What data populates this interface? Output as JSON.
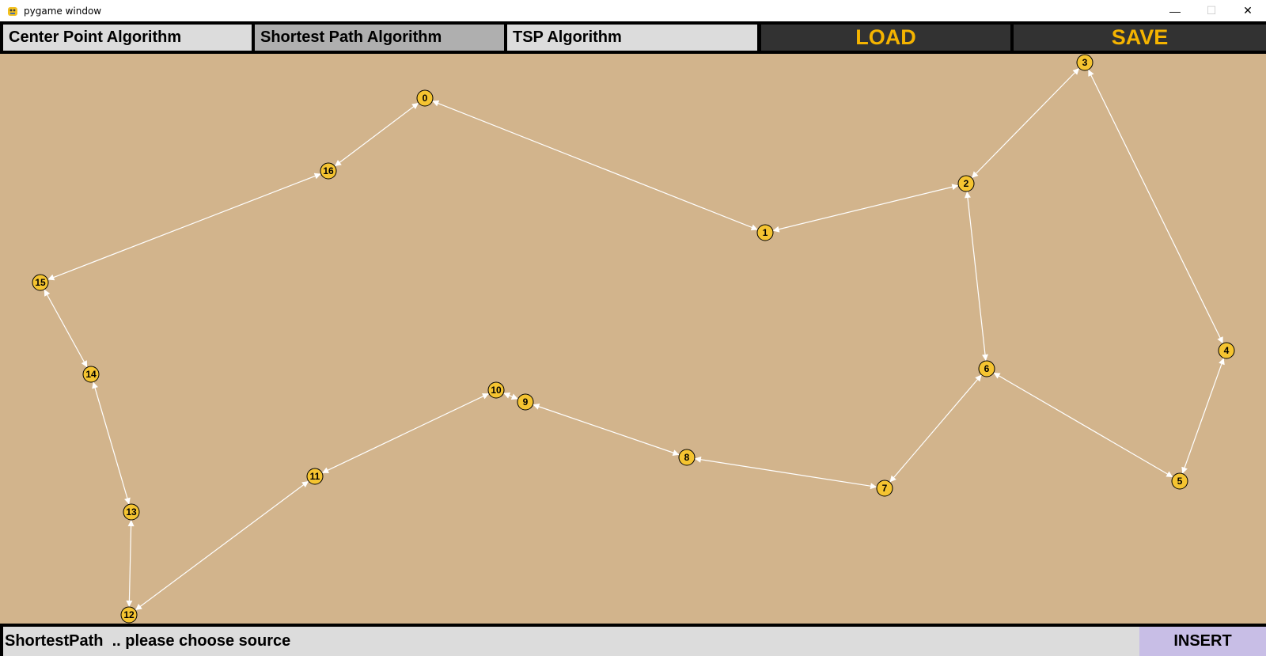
{
  "window": {
    "title": "pygame window",
    "app_icon": "pygame-snake-icon",
    "controls": [
      "minimize-icon",
      "maximize-icon",
      "close-icon"
    ]
  },
  "toolbar": {
    "center_point": "Center Point Algorithm",
    "shortest_path": "Shortest Path Algorithm",
    "tsp": "TSP Algorithm",
    "load": "LOAD",
    "save": "SAVE",
    "selected": "shortest_path"
  },
  "colors": {
    "canvas": "#d2b48c",
    "node_fill": "#f5c431",
    "edge": "#ffffff",
    "button_default": "#dcdcdc",
    "button_selected": "#afafaf",
    "file_button_bg": "#323232",
    "file_button_text": "#f5b400",
    "insert_bg": "#c8bee6"
  },
  "graph": {
    "nodes": [
      {
        "id": "0"
      },
      {
        "id": "1"
      },
      {
        "id": "2"
      },
      {
        "id": "3"
      },
      {
        "id": "4"
      },
      {
        "id": "5"
      },
      {
        "id": "6"
      },
      {
        "id": "7"
      },
      {
        "id": "8"
      },
      {
        "id": "9"
      },
      {
        "id": "10"
      },
      {
        "id": "11"
      },
      {
        "id": "12"
      },
      {
        "id": "13"
      },
      {
        "id": "14"
      },
      {
        "id": "15"
      },
      {
        "id": "16"
      }
    ],
    "edges": [
      [
        "0",
        "1"
      ],
      [
        "0",
        "16"
      ],
      [
        "16",
        "15"
      ],
      [
        "15",
        "14"
      ],
      [
        "14",
        "13"
      ],
      [
        "13",
        "12"
      ],
      [
        "12",
        "11"
      ],
      [
        "11",
        "10"
      ],
      [
        "10",
        "9"
      ],
      [
        "9",
        "8"
      ],
      [
        "8",
        "7"
      ],
      [
        "7",
        "6"
      ],
      [
        "6",
        "2"
      ],
      [
        "6",
        "5"
      ],
      [
        "5",
        "4"
      ],
      [
        "4",
        "3"
      ],
      [
        "3",
        "2"
      ],
      [
        "2",
        "1"
      ]
    ],
    "directed": "both-ways"
  },
  "status": {
    "message": "ShortestPath  .. please choose source",
    "insert_label": "INSERT"
  }
}
